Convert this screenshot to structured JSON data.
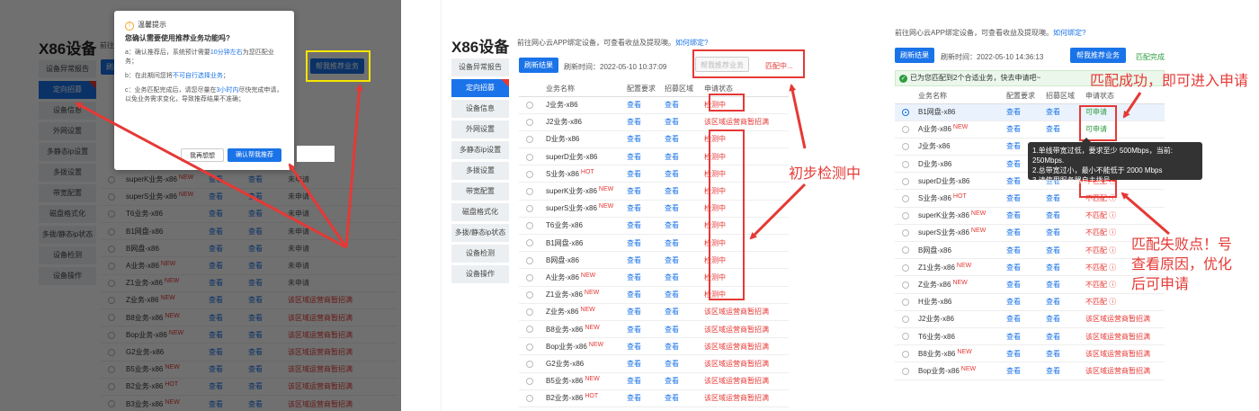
{
  "page_title": "X86设备",
  "notice_text": "前往网心云APP绑定设备，可查看收益及提现噢。",
  "notice_link": "如何绑定?",
  "sidebar": [
    "设备异常报告",
    "定向招募",
    "设备信息",
    "外网设置",
    "多静态ip设置",
    "多拨设置",
    "带宽配置",
    "磁盘格式化",
    "多拨/静态ip状态",
    "设备检测",
    "设备操作"
  ],
  "refresh_label": "刷新结果",
  "recommend_label": "帮我推荐业务",
  "columns": [
    "业务名称",
    "配置要求",
    "招募区域",
    "申请状态"
  ],
  "view_label": "查看",
  "panel1": {
    "rows": [
      {
        "name": "superK业务-x86",
        "tag": "NEW",
        "status": "未申请",
        "st": "gray"
      },
      {
        "name": "superS业务-x86",
        "tag": "NEW",
        "status": "未申请",
        "st": "gray"
      },
      {
        "name": "T6业务-x86",
        "tag": "",
        "status": "未申请",
        "st": "gray"
      },
      {
        "name": "B1网盘-x86",
        "tag": "",
        "status": "未申请",
        "st": "gray"
      },
      {
        "name": "B网盘-x86",
        "tag": "",
        "status": "未申请",
        "st": "gray"
      },
      {
        "name": "A业务-x86",
        "tag": "NEW",
        "status": "未申请",
        "st": "gray"
      },
      {
        "name": "Z1业务-x86",
        "tag": "NEW",
        "status": "未申请",
        "st": "gray"
      },
      {
        "name": "Z业务-x86",
        "tag": "NEW",
        "status": "该区域运营商暂招满",
        "st": "red"
      },
      {
        "name": "B8业务-x86",
        "tag": "NEW",
        "status": "该区域运营商暂招满",
        "st": "red"
      },
      {
        "name": "Bop业务-x86",
        "tag": "NEW",
        "status": "该区域运营商暂招满",
        "st": "red"
      },
      {
        "name": "G2业务-x86",
        "tag": "",
        "status": "该区域运营商暂招满",
        "st": "red"
      },
      {
        "name": "B5业务-x86",
        "tag": "NEW",
        "status": "该区域运营商暂招满",
        "st": "red"
      },
      {
        "name": "B2业务-x86",
        "tag": "HOT",
        "status": "该区域运营商暂招满",
        "st": "red"
      },
      {
        "name": "B3业务-x86",
        "tag": "NEW",
        "status": "该区域运营商暂招满",
        "st": "red"
      }
    ],
    "hidden_status_row2": "该区域运营商暂招满",
    "dialog": {
      "title": "温馨提示",
      "question": "您确认需要使用推荐业务功能吗?",
      "item_a1": "a：确认推荐后，系统预计需要",
      "item_a_time": "10分钟左右",
      "item_a2": "为您匹配业务；",
      "item_b1": "b：在此期间您将",
      "item_b_blue": "不可自行选择业务",
      "item_b2": "；",
      "item_c1": "c：业务匹配完成后，请您尽量在",
      "item_c_time": "3小时内",
      "item_c2": "尽快完成申请，以免业务需求变化，导致推荐结果不准确；",
      "cancel": "我再想想",
      "confirm": "确认帮我推荐"
    }
  },
  "panel2": {
    "refresh_time_label": "刷新时间：",
    "refresh_time": "2022-05-10 10:37:09",
    "matching_label": "匹配中...",
    "rows": [
      {
        "name": "J业务-x86",
        "tag": "",
        "status": "检测中",
        "st": "red"
      },
      {
        "name": "J2业务-x86",
        "tag": "",
        "status": "该区域运营商暂招满",
        "st": "red"
      },
      {
        "name": "D业务-x86",
        "tag": "",
        "status": "检测中",
        "st": "red"
      },
      {
        "name": "superD业务-x86",
        "tag": "",
        "status": "检测中",
        "st": "red"
      },
      {
        "name": "S业务-x86",
        "tag": "HOT",
        "status": "检测中",
        "st": "red"
      },
      {
        "name": "superK业务-x86",
        "tag": "NEW",
        "status": "检测中",
        "st": "red"
      },
      {
        "name": "superS业务-x86",
        "tag": "NEW",
        "status": "检测中",
        "st": "red"
      },
      {
        "name": "T6业务-x86",
        "tag": "",
        "status": "检测中",
        "st": "red"
      },
      {
        "name": "B1网盘-x86",
        "tag": "",
        "status": "检测中",
        "st": "red"
      },
      {
        "name": "B网盘-x86",
        "tag": "",
        "status": "检测中",
        "st": "red"
      },
      {
        "name": "A业务-x86",
        "tag": "NEW",
        "status": "检测中",
        "st": "red"
      },
      {
        "name": "Z1业务-x86",
        "tag": "NEW",
        "status": "检测中",
        "st": "red"
      },
      {
        "name": "Z业务-x86",
        "tag": "NEW",
        "status": "该区域运营商暂招满",
        "st": "red"
      },
      {
        "name": "B8业务-x86",
        "tag": "NEW",
        "status": "该区域运营商暂招满",
        "st": "red"
      },
      {
        "name": "Bop业务-x86",
        "tag": "NEW",
        "status": "该区域运营商暂招满",
        "st": "red"
      },
      {
        "name": "G2业务-x86",
        "tag": "",
        "status": "该区域运营商暂招满",
        "st": "red"
      },
      {
        "name": "B5业务-x86",
        "tag": "NEW",
        "status": "该区域运营商暂招满",
        "st": "red"
      },
      {
        "name": "B2业务-x86",
        "tag": "HOT",
        "status": "该区域运营商暂招满",
        "st": "red"
      }
    ]
  },
  "panel3": {
    "refresh_time_label": "刷新时间：",
    "refresh_time": "2022-05-10 14:36:13",
    "match_done": "匹配完成",
    "success_banner": "已为您匹配到2个合适业务，快去申请吧~",
    "rows": [
      {
        "name": "B1网盘-x86",
        "tag": "",
        "status": "可申请",
        "st": "green",
        "sel": true
      },
      {
        "name": "A业务-x86",
        "tag": "NEW",
        "status": "可申请",
        "st": "green"
      },
      {
        "name": "J业务-x86",
        "tag": "",
        "status": "",
        "st": "red"
      },
      {
        "name": "D业务-x86",
        "tag": "",
        "status": "",
        "st": "red"
      },
      {
        "name": "superD业务-x86",
        "tag": "",
        "status": "不匹配 ⓘ",
        "st": "red"
      },
      {
        "name": "S业务-x86",
        "tag": "HOT",
        "status": "不匹配 ⓘ",
        "st": "red"
      },
      {
        "name": "superK业务-x86",
        "tag": "NEW",
        "status": "不匹配 ⓘ",
        "st": "red"
      },
      {
        "name": "superS业务-x86",
        "tag": "NEW",
        "status": "不匹配 ⓘ",
        "st": "red"
      },
      {
        "name": "B网盘-x86",
        "tag": "",
        "status": "不匹配 ⓘ",
        "st": "red"
      },
      {
        "name": "Z1业务-x86",
        "tag": "NEW",
        "status": "不匹配 ⓘ",
        "st": "red"
      },
      {
        "name": "Z业务-x86",
        "tag": "NEW",
        "status": "不匹配 ⓘ",
        "st": "red"
      },
      {
        "name": "H业务-x86",
        "tag": "",
        "status": "不匹配 ⓘ",
        "st": "red"
      },
      {
        "name": "J2业务-x86",
        "tag": "",
        "status": "该区域运营商暂招满",
        "st": "red"
      },
      {
        "name": "T6业务-x86",
        "tag": "",
        "status": "该区域运营商暂招满",
        "st": "red"
      },
      {
        "name": "B8业务-x86",
        "tag": "NEW",
        "status": "该区域运营商暂招满",
        "st": "red"
      },
      {
        "name": "Bop业务-x86",
        "tag": "NEW",
        "status": "该区域运营商暂招满",
        "st": "red"
      }
    ],
    "tooltip": [
      "1.单线带宽过低，要求至少 500Mbps，当前: 250Mbps.",
      "2.总带宽过小，最小不能低于 2000 Mbps",
      "3.请使用服务器自主拨号。"
    ]
  },
  "annotations": {
    "initial_check": "初步检测中",
    "match_success": "匹配成功，即可进入申请",
    "match_fail_1": "匹配失败点！号",
    "match_fail_2": "查看原因，优化",
    "match_fail_3": "后可申请"
  }
}
